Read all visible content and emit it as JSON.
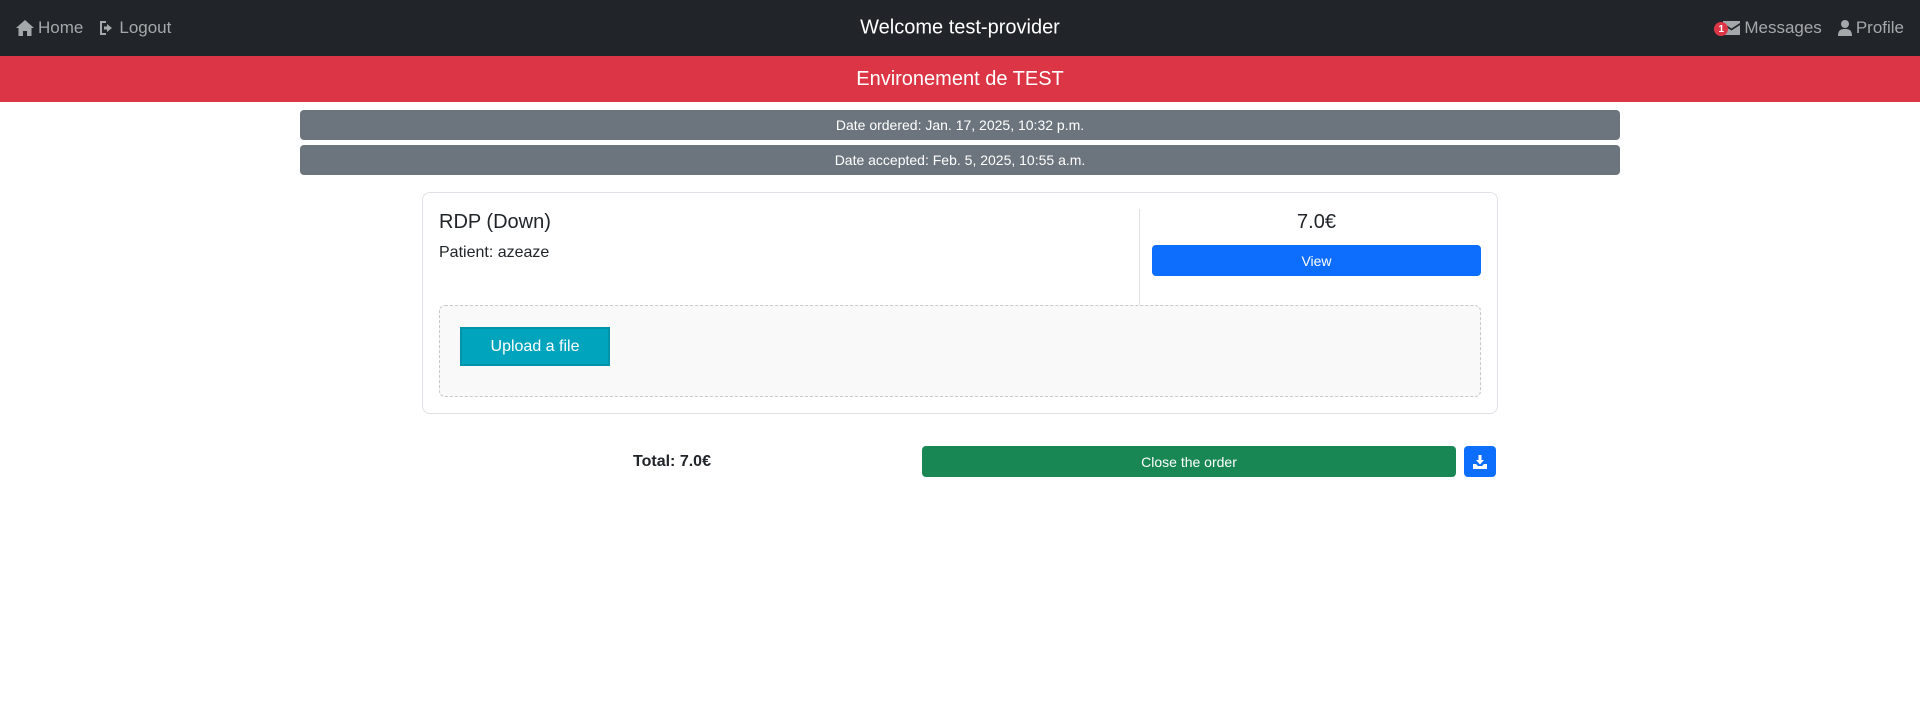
{
  "navbar": {
    "home_label": "Home",
    "logout_label": "Logout",
    "title": "Welcome test-provider",
    "messages_label": "Messages",
    "messages_count": "1",
    "profile_label": "Profile"
  },
  "environment_banner": "Environement de TEST",
  "dates": {
    "ordered": "Date ordered: Jan. 17, 2025, 10:32 p.m.",
    "accepted": "Date accepted: Feb. 5, 2025, 10:55 a.m."
  },
  "order_item": {
    "name": "RDP (Down)",
    "patient": "Patient: azeaze",
    "price": "7.0€",
    "view_label": "View",
    "upload_label": "Upload a file"
  },
  "footer": {
    "total": "Total: 7.0€",
    "close_label": "Close the order"
  },
  "colors": {
    "navbar": "#212529",
    "banner": "#dc3545",
    "date_bar": "#6c757d",
    "primary": "#0d6efd",
    "success": "#198754",
    "upload": "#00a4bd"
  },
  "icons": [
    "home-icon",
    "logout-icon",
    "envelope-icon",
    "user-icon",
    "download-icon"
  ]
}
